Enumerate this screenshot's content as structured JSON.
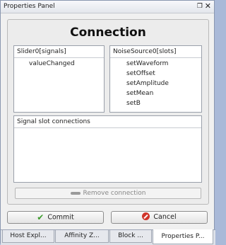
{
  "panel": {
    "title": "Properties Panel",
    "restore_icon": "restore-icon",
    "close_icon": "close-icon"
  },
  "connection": {
    "heading": "Connection",
    "signals": {
      "header": "Slider0[signals]",
      "items": [
        "valueChanged"
      ]
    },
    "slots": {
      "header": "NoiseSource0[slots]",
      "items": [
        "setWaveform",
        "setOffset",
        "setAmplitude",
        "setMean",
        "setB"
      ]
    },
    "connections": {
      "header": "Signal slot connections"
    },
    "remove_label": "Remove connection",
    "remove_icon": "minus-icon"
  },
  "buttons": {
    "commit_label": "Commit",
    "commit_icon": "check-icon",
    "cancel_label": "Cancel",
    "cancel_icon": "cancel-icon"
  },
  "tabs": [
    {
      "label": "Host Expl..."
    },
    {
      "label": "Affinity Z..."
    },
    {
      "label": "Block ..."
    },
    {
      "label": "Properties P..."
    }
  ],
  "colors": {
    "commit_icon": "#3b9b2a",
    "cancel_icon": "#d0342a"
  }
}
